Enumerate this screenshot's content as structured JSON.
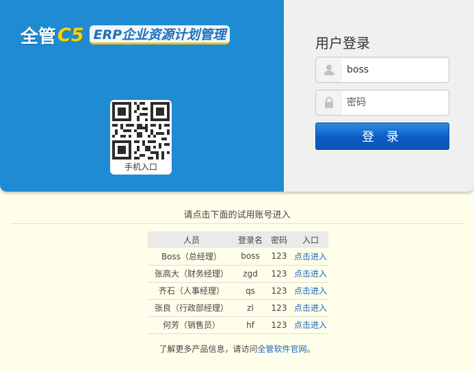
{
  "brand": {
    "name": "全管",
    "version": "C5",
    "product": "ERP企业资源计划管理"
  },
  "qr": {
    "label": "手机入口"
  },
  "login": {
    "title": "用户登录",
    "username_value": "boss",
    "password_placeholder": "密码",
    "button_label": "登 录"
  },
  "trial": {
    "prompt": "请点击下面的试用账号进入",
    "columns": [
      "人员",
      "登录名",
      "密码",
      "入口"
    ],
    "rows": [
      {
        "person": "Boss（总经理）",
        "login": "boss",
        "password": "123",
        "entry": "点击进入"
      },
      {
        "person": "张高大（财务经理）",
        "login": "zgd",
        "password": "123",
        "entry": "点击进入"
      },
      {
        "person": "齐石（人事经理）",
        "login": "qs",
        "password": "123",
        "entry": "点击进入"
      },
      {
        "person": "张良（行政部经理）",
        "login": "zl",
        "password": "123",
        "entry": "点击进入"
      },
      {
        "person": "何芳（销售员）",
        "login": "hf",
        "password": "123",
        "entry": "点击进入"
      }
    ]
  },
  "footer": {
    "text_before": "了解更多产品信息，请访问",
    "link": "全管软件官网",
    "text_after": "。"
  },
  "colors": {
    "panel_blue": "#1f8bd3",
    "button_blue": "#0a5dc5",
    "link_blue": "#1a66c2",
    "page_bg": "#fefeea"
  },
  "icons": [
    "user-icon",
    "lock-icon",
    "qr-code-icon"
  ]
}
